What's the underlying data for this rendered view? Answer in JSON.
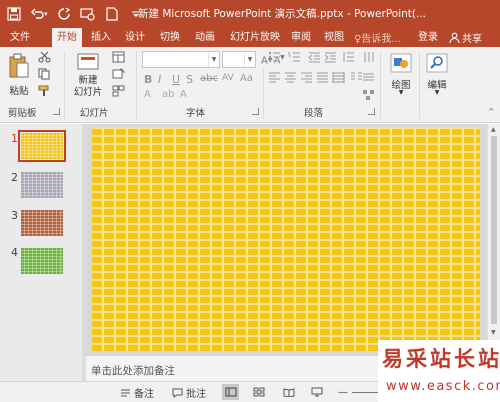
{
  "app": {
    "title": "新建 Microsoft PowerPoint 演示文稿.pptx - PowerPoint(...",
    "accent_color": "#b7472a"
  },
  "qat": {
    "icons": [
      "save-icon",
      "undo-icon",
      "undo-dropdown-icon",
      "redo-icon",
      "slideshow-from-start-icon",
      "new-file-icon",
      "customize-qat-icon"
    ]
  },
  "tabs": [
    {
      "label": "文件"
    },
    {
      "label": "开始"
    },
    {
      "label": "插入"
    },
    {
      "label": "设计"
    },
    {
      "label": "切换"
    },
    {
      "label": "动画"
    },
    {
      "label": "幻灯片放映"
    },
    {
      "label": "审阅"
    },
    {
      "label": "视图"
    }
  ],
  "active_tab": "开始",
  "tell_me": "♀告诉我...",
  "login": "登录",
  "share": "共享",
  "ribbon": {
    "clipboard": {
      "paste": "粘贴",
      "label": "剪贴板"
    },
    "slides": {
      "new_slide": "新建\n幻灯片",
      "label": "幻灯片"
    },
    "font": {
      "label": "字体"
    },
    "paragraph": {
      "label": "段落"
    },
    "drawing": {
      "label": "绘图"
    },
    "editing": {
      "label": "编辑"
    }
  },
  "slides": [
    {
      "number": "1",
      "fill_color": "#f5c518",
      "selected": true
    },
    {
      "number": "2",
      "fill_color": "#a8a8b5",
      "selected": false
    },
    {
      "number": "3",
      "fill_color": "#b5603a",
      "selected": false
    },
    {
      "number": "4",
      "fill_color": "#6db33f",
      "selected": false
    }
  ],
  "current_slide_color": "#f5c518",
  "notes": {
    "placeholder": "单击此处添加备注"
  },
  "statusbar": {
    "notes": "备注",
    "comments": "批注"
  },
  "watermark": {
    "text": "易采站长站",
    "url": "www.easck.com"
  }
}
